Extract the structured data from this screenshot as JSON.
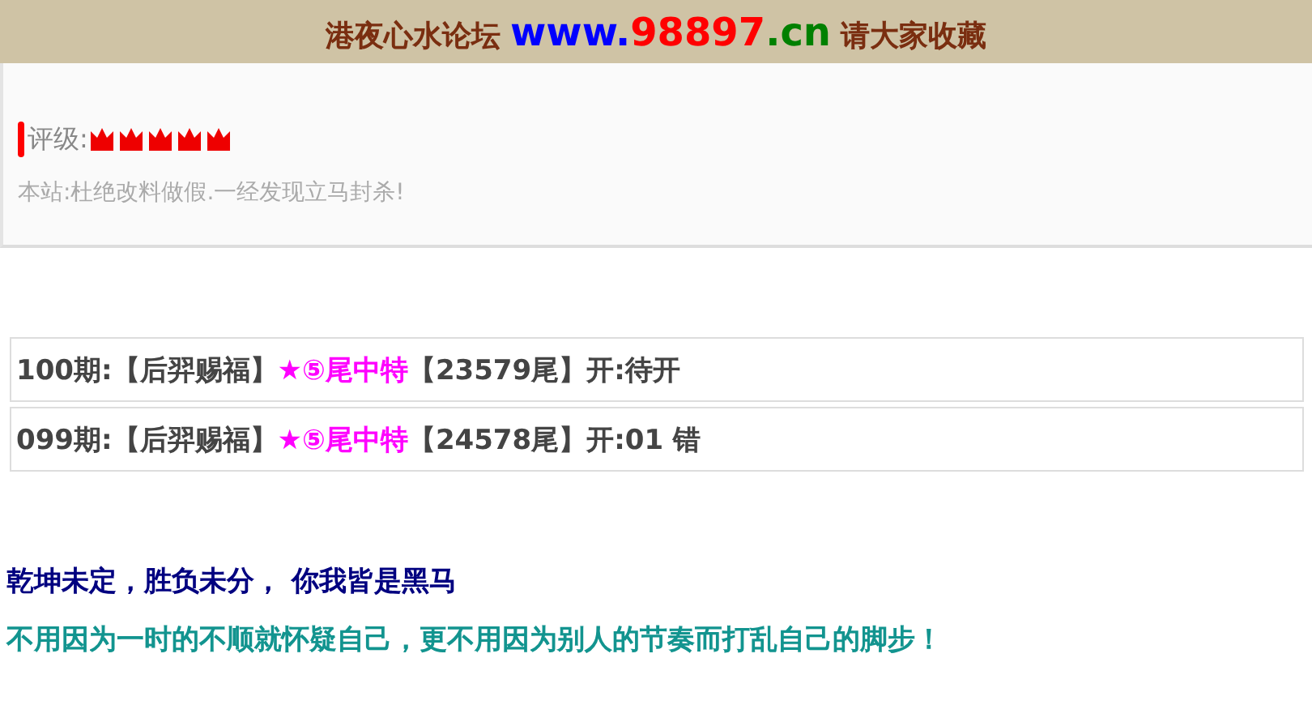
{
  "banner": {
    "parts": [
      {
        "kind": "name",
        "text": "港夜心水论坛"
      },
      {
        "kind": "www",
        "text": "www."
      },
      {
        "kind": "domain",
        "text": "98897"
      },
      {
        "kind": "tld",
        "text": ".cn"
      },
      {
        "kind": "name",
        "text": "请大家收藏"
      }
    ]
  },
  "rating": {
    "label": "评级:",
    "stars": 5
  },
  "notice": "本站:杜绝改料做假.一经发现立马封杀!",
  "rows": [
    {
      "parts": [
        {
          "kind": "plain",
          "text": "100期:【后羿赐福】"
        },
        {
          "kind": "pick",
          "text": "★⑤尾中特"
        },
        {
          "kind": "plain",
          "text": "【23579尾】开:待开"
        }
      ]
    },
    {
      "parts": [
        {
          "kind": "plain",
          "text": "099期:【后羿赐福】"
        },
        {
          "kind": "pick",
          "text": "★⑤尾中特"
        },
        {
          "kind": "plain",
          "text": "【24578尾】开:01 错"
        }
      ]
    }
  ],
  "slogans": [
    {
      "kind": "dark",
      "text": "乾坤未定，胜负未分，  你我皆是黑马"
    },
    {
      "kind": "teal",
      "text": "不用因为一时的不顺就怀疑自己，更不用因为别人的节奏而打乱自己的脚步！"
    }
  ]
}
